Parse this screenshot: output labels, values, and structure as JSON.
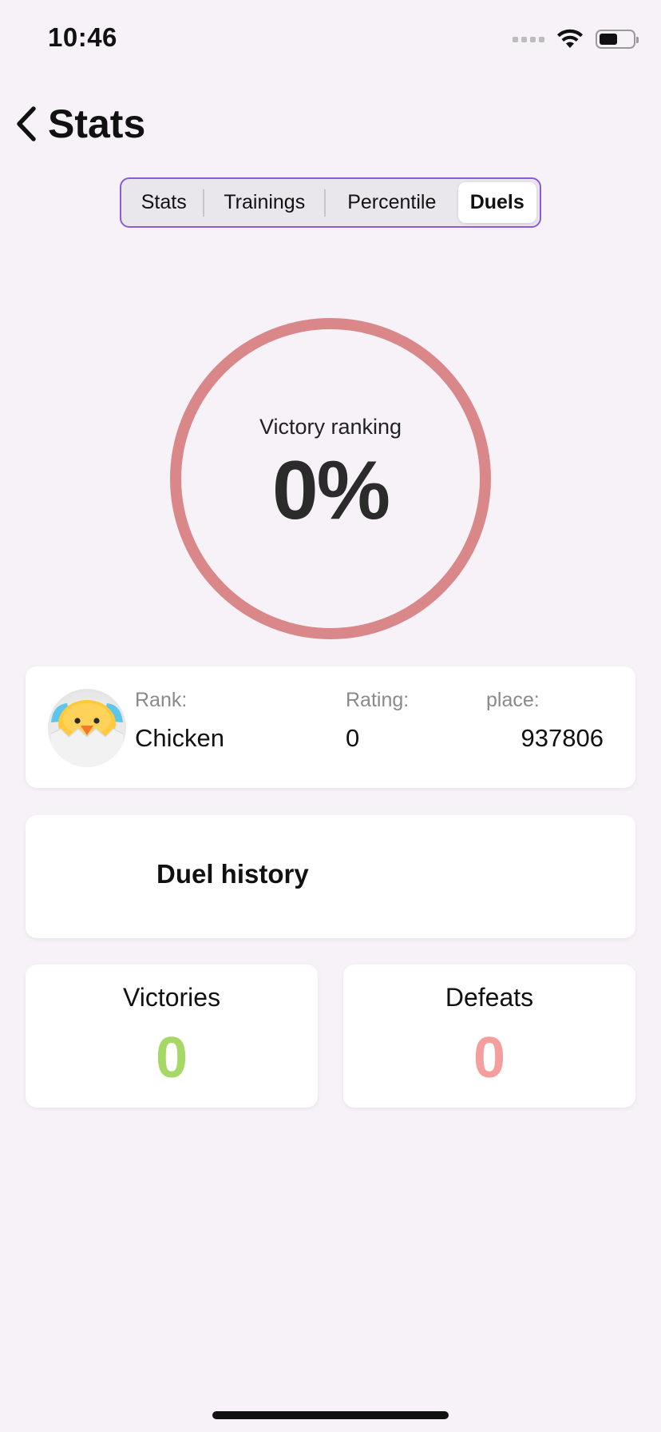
{
  "status_bar": {
    "time": "10:46"
  },
  "header": {
    "title": "Stats"
  },
  "tabs": [
    {
      "label": "Stats",
      "active": false
    },
    {
      "label": "Trainings",
      "active": false
    },
    {
      "label": "Percentile",
      "active": false
    },
    {
      "label": "Duels",
      "active": true
    }
  ],
  "victory": {
    "label": "Victory ranking",
    "value": "0%",
    "ring_color": "#DA878A"
  },
  "rank_card": {
    "rank_label": "Rank:",
    "rank_value": "Chicken",
    "rating_label": "Rating:",
    "rating_value": "0",
    "place_label": "place:",
    "place_value": "937806",
    "avatar_icon": "hatching-chick-icon"
  },
  "history": {
    "title": "Duel history"
  },
  "victories": {
    "label": "Victories",
    "value": "0",
    "color": "#A6D865"
  },
  "defeats": {
    "label": "Defeats",
    "value": "0",
    "color": "#F59E9E"
  },
  "colors": {
    "accent": "#8E5BD8",
    "background": "#F6F2F8"
  }
}
